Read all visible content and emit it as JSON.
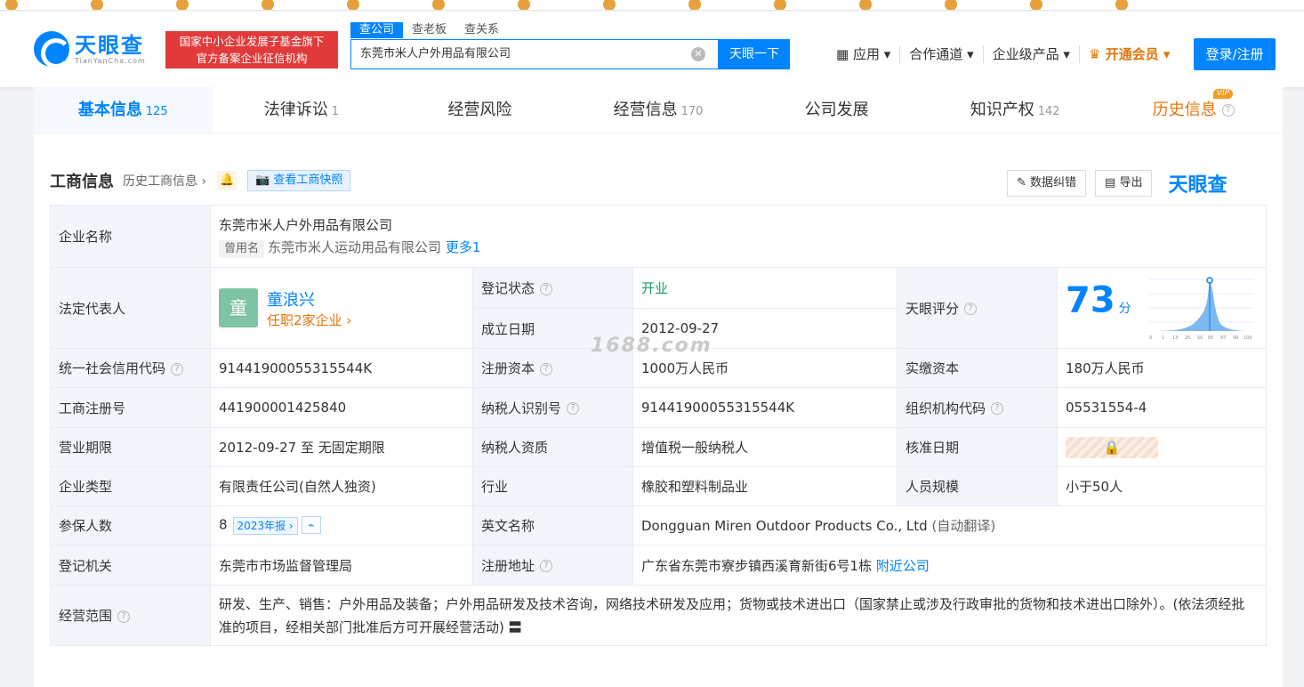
{
  "header": {
    "logo_cn": "天眼查",
    "logo_en": "TianYanCha.com",
    "badge_line1": "国家中小企业发展子基金旗下",
    "badge_line2": "官方备案企业征信机构",
    "search_tabs": [
      "查公司",
      "查老板",
      "查关系"
    ],
    "search_value": "东莞市米人户外用品有限公司",
    "search_button": "天眼一下",
    "nav": [
      "应用",
      "合作通道",
      "企业级产品",
      "开通会员"
    ],
    "login": "登录/注册"
  },
  "tabs": [
    {
      "label": "基本信息",
      "count": "125"
    },
    {
      "label": "法律诉讼",
      "count": "1"
    },
    {
      "label": "经营风险",
      "count": ""
    },
    {
      "label": "经营信息",
      "count": "170"
    },
    {
      "label": "公司发展",
      "count": ""
    },
    {
      "label": "知识产权",
      "count": "142"
    },
    {
      "label": "历史信息",
      "count": "",
      "badge": "VIP"
    }
  ],
  "section": {
    "title": "工商信息",
    "history": "历史工商信息 ›",
    "snapshot": "查看工商快照",
    "correct": "数据纠错",
    "export": "导出",
    "watermark": "天眼查"
  },
  "info": {
    "company_name_key": "企业名称",
    "company_name": "东莞市米人户外用品有限公司",
    "former_tag": "曾用名",
    "former_name": "东莞市米人运动用品有限公司",
    "more": "更多1",
    "rep_key": "法定代表人",
    "rep_avatar": "童",
    "rep_name": "童浪兴",
    "rep_sub": "任职2家企业 ›",
    "status_key": "登记状态",
    "status": "开业",
    "found_key": "成立日期",
    "found": "2012-09-27",
    "score_key": "天眼评分",
    "score": "73",
    "score_unit": "分",
    "ucc_key": "统一社会信用代码",
    "ucc": "91441900055315544K",
    "capital_key": "注册资本",
    "capital": "1000万人民币",
    "paid_key": "实缴资本",
    "paid": "180万人民币",
    "reg_no_key": "工商注册号",
    "reg_no": "441900001425840",
    "tax_key": "纳税人识别号",
    "tax": "91441900055315544K",
    "org_key": "组织机构代码",
    "org": "05531554-4",
    "term_key": "营业期限",
    "term": "2012-09-27 至 无固定期限",
    "taxq_key": "纳税人资质",
    "taxq": "增值税一般纳税人",
    "approve_key": "核准日期",
    "type_key": "企业类型",
    "type": "有限责任公司(自然人独资)",
    "industry_key": "行业",
    "industry": "橡胶和塑料制品业",
    "staff_key": "人员规模",
    "staff": "小于50人",
    "insured_key": "参保人数",
    "insured": "8",
    "insured_year": "2023年报 ›",
    "en_key": "英文名称",
    "en": "Dongguan Miren Outdoor Products Co., Ltd",
    "en_note": "(自动翻译)",
    "authority_key": "登记机关",
    "authority": "东莞市市场监督管理局",
    "addr_key": "注册地址",
    "addr": "广东省东莞市寮步镇西溪育新街6号1栋",
    "addr_link": "附近公司",
    "scope_key": "经营范围",
    "scope": "研发、生产、销售：户外用品及装备；户外用品研发及技术咨询，网络技术研发及应用；货物或技术进出口（国家禁止或涉及行政审批的货物和技术进出口除外）。(依法须经批准的项目，经相关部门批准后方可开展经营活动)"
  },
  "overlay_watermark": "1688.com",
  "score_axis": [
    "0",
    "1",
    "13",
    "25",
    "50",
    "85",
    "97",
    "99",
    "100"
  ]
}
